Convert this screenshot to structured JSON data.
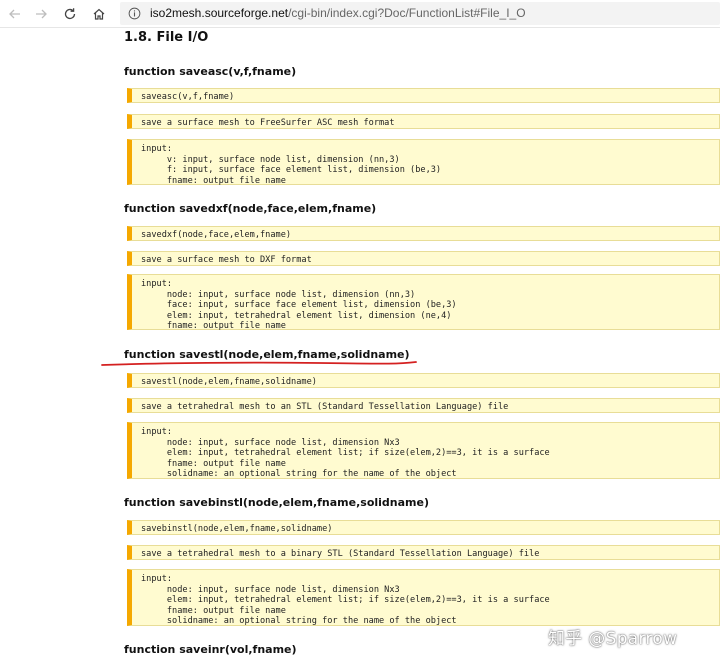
{
  "browser": {
    "url_host": "iso2mesh.sourceforge.net",
    "url_path": "/cgi-bin/index.cgi?Doc/FunctionList#File_I_O",
    "back_icon": "arrow-left-icon",
    "forward_icon": "arrow-right-icon",
    "refresh_icon": "refresh-icon",
    "home_icon": "home-icon",
    "info_icon": "info-icon"
  },
  "page": {
    "section_title": "1.8. File I/O",
    "functions": [
      {
        "heading": "function saveasc(v,f,fname)",
        "usage": "saveasc(v,f,fname)",
        "description": "save a surface mesh to FreeSurfer ASC mesh format",
        "params": "input:\n     v: input, surface node list, dimension (nn,3)\n     f: input, surface face element list, dimension (be,3)\n     fname: output file name"
      },
      {
        "heading": "function savedxf(node,face,elem,fname)",
        "usage": "savedxf(node,face,elem,fname)",
        "description": "save a surface mesh to DXF format",
        "params": "input:\n     node: input, surface node list, dimension (nn,3)\n     face: input, surface face element list, dimension (be,3)\n     elem: input, tetrahedral element list, dimension (ne,4)\n     fname: output file name"
      },
      {
        "heading": "function savestl(node,elem,fname,solidname)",
        "usage": "savestl(node,elem,fname,solidname)",
        "description": "save a tetrahedral mesh to an STL (Standard Tessellation Language) file",
        "params": "input:\n     node: input, surface node list, dimension Nx3\n     elem: input, tetrahedral element list; if size(elem,2)==3, it is a surface\n     fname: output file name\n     solidname: an optional string for the name of the object"
      },
      {
        "heading": "function savebinstl(node,elem,fname,solidname)",
        "usage": "savebinstl(node,elem,fname,solidname)",
        "description": "save a tetrahedral mesh to a binary STL (Standard Tessellation Language) file",
        "params": "input:\n     node: input, surface node list, dimension Nx3\n     elem: input, tetrahedral element list; if size(elem,2)==3, it is a surface\n     fname: output file name\n     solidname: an optional string for the name of the object"
      },
      {
        "heading": "function saveinr(vol,fname)"
      }
    ]
  },
  "watermark": "知乎 @Sparrow",
  "colors": {
    "box_background": "#fffbd0",
    "box_accent": "#f5a800",
    "annotation_red": "#d42020"
  }
}
